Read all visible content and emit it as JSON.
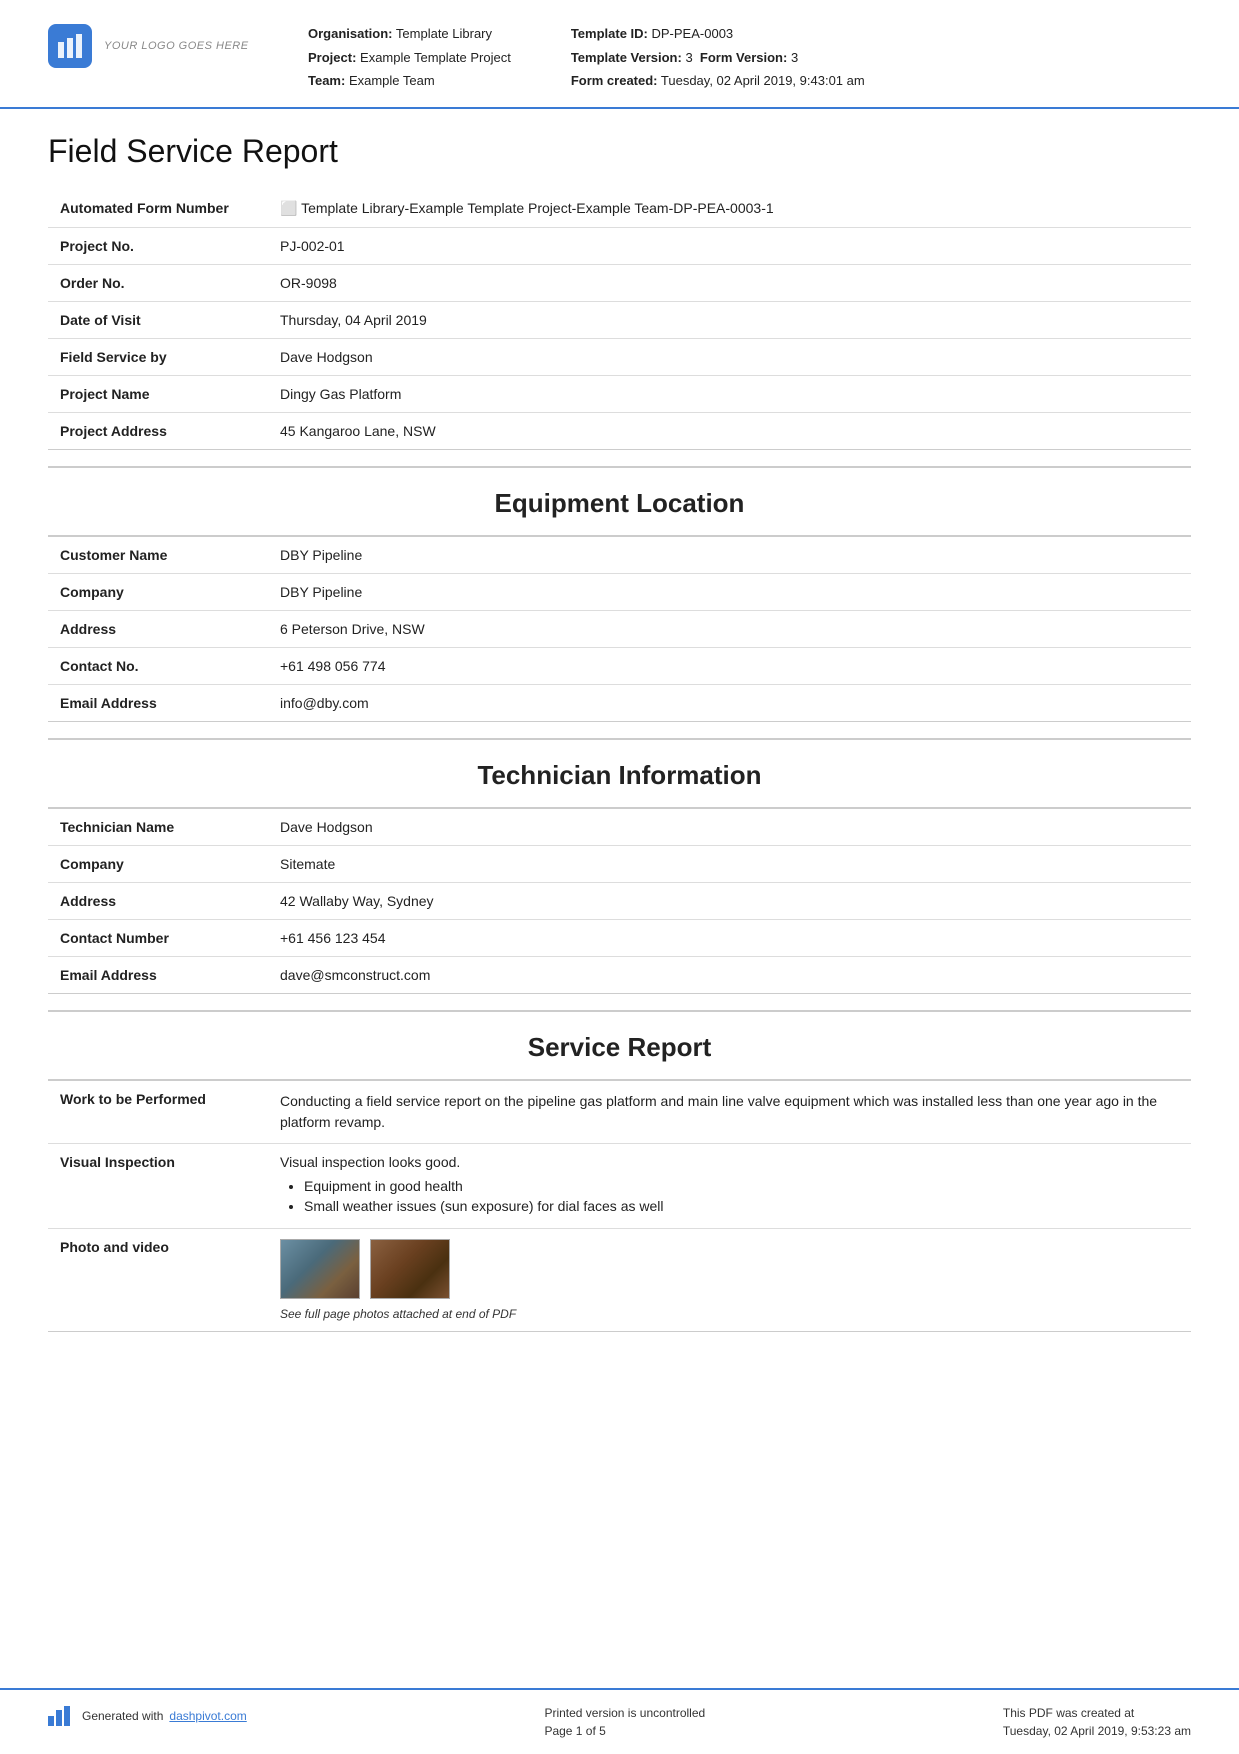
{
  "header": {
    "logo_text": "YOUR LOGO GOES HERE",
    "org_label": "Organisation:",
    "org_value": "Template Library",
    "project_label": "Project:",
    "project_value": "Example Template Project",
    "team_label": "Team:",
    "team_value": "Example Team",
    "template_id_label": "Template ID:",
    "template_id_value": "DP-PEA-0003",
    "template_version_label": "Template Version:",
    "template_version_value": "3",
    "form_version_label": "Form Version:",
    "form_version_value": "3",
    "form_created_label": "Form created:",
    "form_created_value": "Tuesday, 02 April 2019, 9:43:01 am"
  },
  "page_title": "Field Service Report",
  "form_fields": [
    {
      "label": "Automated Form Number",
      "value": "⬜ Template Library-Example Template Project-Example Team-DP-PEA-0003-1"
    },
    {
      "label": "Project No.",
      "value": "PJ-002-01"
    },
    {
      "label": "Order No.",
      "value": "OR-9098"
    },
    {
      "label": "Date of Visit",
      "value": "Thursday, 04 April 2019"
    },
    {
      "label": "Field Service by",
      "value": "Dave Hodgson"
    },
    {
      "label": "Project Name",
      "value": "Dingy Gas Platform"
    },
    {
      "label": "Project Address",
      "value": "45 Kangaroo Lane, NSW"
    }
  ],
  "sections": [
    {
      "id": "equipment-location",
      "title": "Equipment Location",
      "fields": [
        {
          "label": "Customer Name",
          "value": "DBY Pipeline"
        },
        {
          "label": "Company",
          "value": "DBY Pipeline"
        },
        {
          "label": "Address",
          "value": "6 Peterson Drive, NSW"
        },
        {
          "label": "Contact No.",
          "value": "+61 498 056 774"
        },
        {
          "label": "Email Address",
          "value": "info@dby.com"
        }
      ]
    },
    {
      "id": "technician-information",
      "title": "Technician Information",
      "fields": [
        {
          "label": "Technician Name",
          "value": "Dave Hodgson"
        },
        {
          "label": "Company",
          "value": "Sitemate"
        },
        {
          "label": "Address",
          "value": "42 Wallaby Way, Sydney"
        },
        {
          "label": "Contact Number",
          "value": "+61 456 123 454"
        },
        {
          "label": "Email Address",
          "value": "dave@smconstruct.com"
        }
      ]
    },
    {
      "id": "service-report",
      "title": "Service Report",
      "fields": [
        {
          "label": "Work to be Performed",
          "value": "Conducting a field service report on the pipeline gas platform and main line valve equipment which was installed less than one year ago in the platform revamp.",
          "type": "text"
        },
        {
          "label": "Visual Inspection",
          "value": "Visual inspection looks good.",
          "bullets": [
            "Equipment in good health",
            "Small weather issues (sun exposure) for dial faces as well"
          ],
          "type": "bullets"
        },
        {
          "label": "Photo and video",
          "caption": "See full page photos attached at end of PDF",
          "type": "photos"
        }
      ]
    }
  ],
  "footer": {
    "generated_text": "Generated with ",
    "link_text": "dashpivot.com",
    "uncontrolled_text": "Printed version is uncontrolled",
    "page_text": "Page 1 of 5",
    "pdf_created_label": "This PDF was created at",
    "pdf_created_value": "Tuesday, 02 April 2019, 9:53:23 am"
  }
}
